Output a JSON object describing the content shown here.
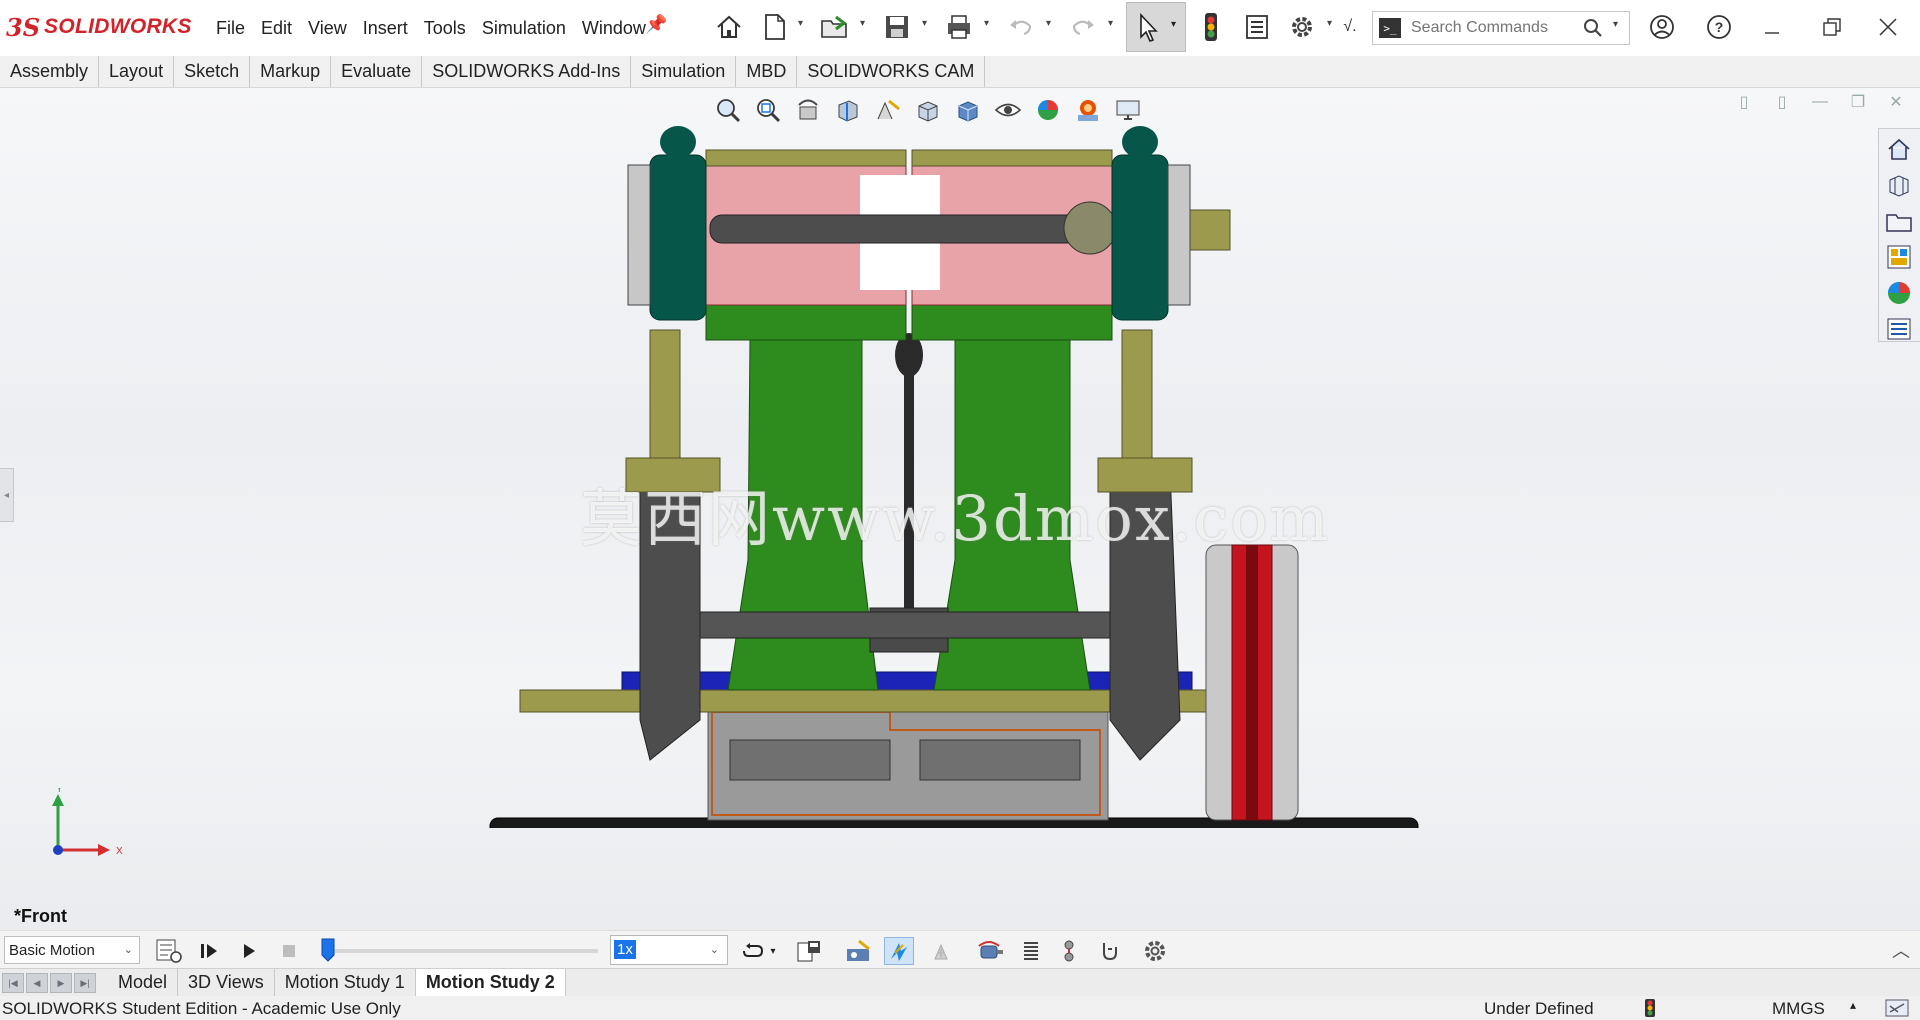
{
  "app": {
    "logo_prefix": "3S",
    "logo_name": "SOLIDWORKS"
  },
  "menus": [
    "File",
    "Edit",
    "View",
    "Insert",
    "Tools",
    "Simulation",
    "Window"
  ],
  "search": {
    "prompt_symbol": ">_",
    "placeholder": "Search Commands"
  },
  "command_tabs": [
    "Assembly",
    "Layout",
    "Sketch",
    "Markup",
    "Evaluate",
    "SOLIDWORKS Add-Ins",
    "Simulation",
    "MBD",
    "SOLIDWORKS CAM"
  ],
  "viewport": {
    "watermark": "莫西网www.3dmox.com",
    "view_name": "*Front",
    "triad": {
      "y": "Y",
      "x": "X"
    }
  },
  "motion": {
    "study_type": "Basic Motion",
    "playback_speed": "1x",
    "timeline_position": 0.0
  },
  "bottom_tabs": [
    {
      "label": "Model",
      "active": false
    },
    {
      "label": "3D Views",
      "active": false
    },
    {
      "label": "Motion Study 1",
      "active": false
    },
    {
      "label": "Motion Study 2",
      "active": true
    }
  ],
  "status": {
    "edition": "SOLIDWORKS Student Edition - Academic Use Only",
    "definition": "Under Defined",
    "units": "MMGS"
  },
  "colors": {
    "brand": "#d2232a",
    "engine_green": "#2e8b1e",
    "cylinder_pink": "#e7a3a8",
    "flywheel_red": "#c4141d",
    "accent_blue": "#1a73e8"
  }
}
